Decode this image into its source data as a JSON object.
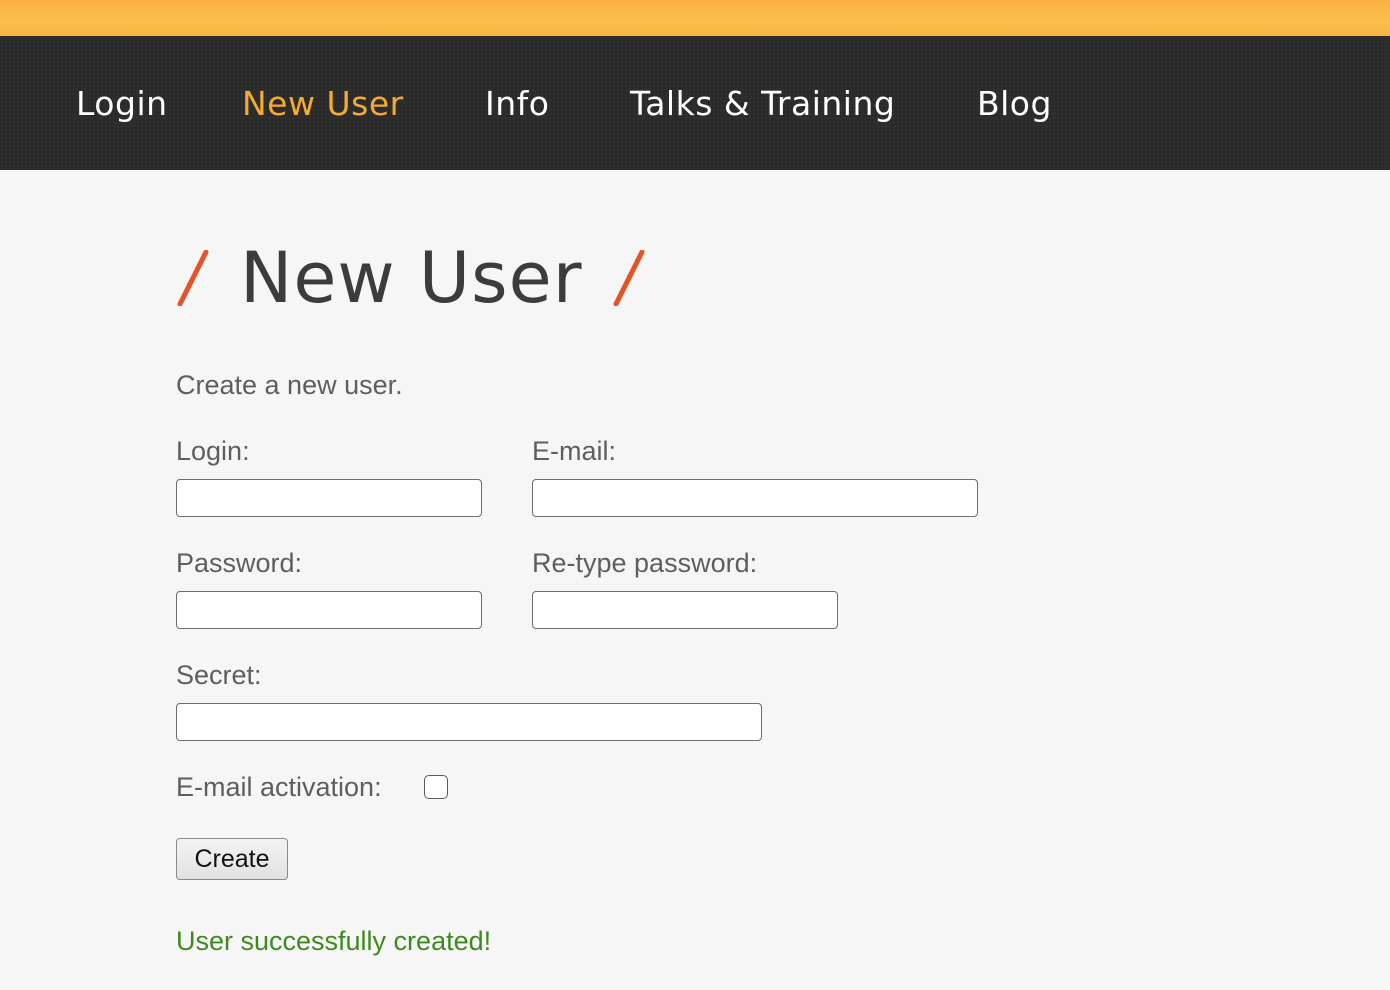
{
  "nav": {
    "items": [
      {
        "label": "Login"
      },
      {
        "label": "New User"
      },
      {
        "label": "Info"
      },
      {
        "label": "Talks & Training"
      },
      {
        "label": "Blog"
      }
    ],
    "active_index": 1
  },
  "page": {
    "title": "New User",
    "intro": "Create a new user."
  },
  "form": {
    "login_label": "Login:",
    "login_value": "",
    "email_label": "E-mail:",
    "email_value": "",
    "password_label": "Password:",
    "password_value": "",
    "retype_label": "Re-type password:",
    "retype_value": "",
    "secret_label": "Secret:",
    "secret_value": "",
    "email_activation_label": "E-mail activation:",
    "email_activation_checked": false,
    "create_label": "Create"
  },
  "status": {
    "message": "User successfully created!"
  },
  "colors": {
    "top_stripe": "#fbb13f",
    "navbar_bg": "#2b2b2b",
    "nav_active": "#f5aa33",
    "slash_accent": "#e5532b",
    "success_text": "#3f8a1f"
  }
}
